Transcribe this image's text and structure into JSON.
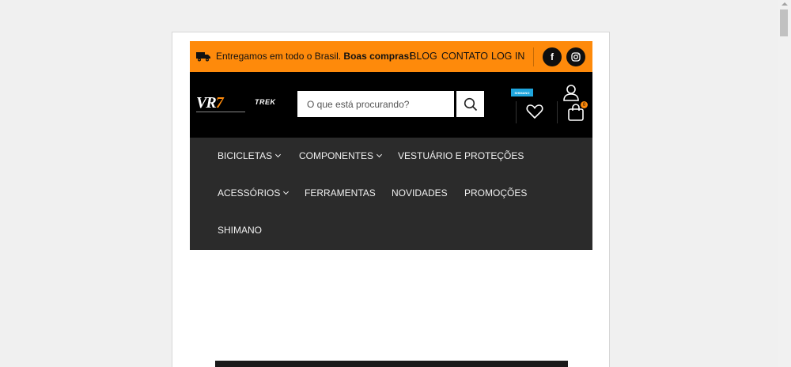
{
  "topbar": {
    "shipping_text": "Entregamos em todo o Brasil. ",
    "shipping_bold": "Boas compras!",
    "links": [
      "BLOG",
      "CONTATO",
      "LOG IN"
    ],
    "social_icons": [
      "facebook-icon",
      "instagram-icon"
    ],
    "facebook_glyph": "f",
    "instagram_glyph": "◎"
  },
  "header": {
    "logo_text": "VR",
    "logo_accent": "7",
    "brand_partner": "TREK",
    "search_placeholder": "O que está procurando?",
    "shimano_badge": "SHIMANO",
    "cart_count": "0"
  },
  "nav": {
    "items": [
      {
        "label": "BICICLETAS",
        "dropdown": true
      },
      {
        "label": "COMPONENTES",
        "dropdown": true
      },
      {
        "label": "VESTUÁRIO E PROTEÇÕES",
        "dropdown": false
      },
      {
        "label": "ACESSÓRIOS",
        "dropdown": true
      },
      {
        "label": "FERRAMENTAS",
        "dropdown": false
      },
      {
        "label": "NOVIDADES",
        "dropdown": false
      },
      {
        "label": "PROMOÇÕES",
        "dropdown": false
      },
      {
        "label": "SHIMANO",
        "dropdown": false
      }
    ]
  },
  "colors": {
    "accent": "#fe8a0b",
    "header_bg": "#000000",
    "nav_bg": "#2b2b2b"
  }
}
